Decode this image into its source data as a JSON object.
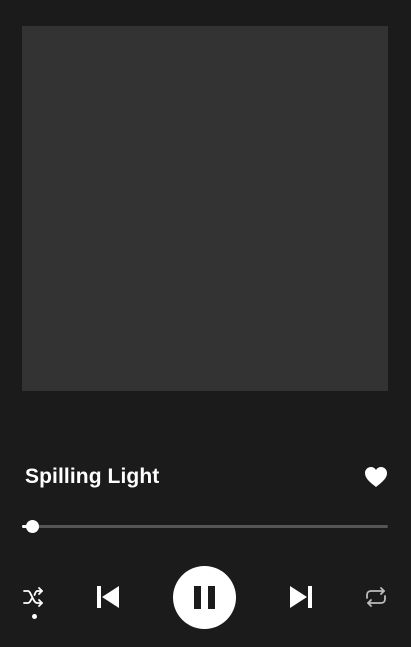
{
  "track": {
    "title": "Spilling Light",
    "liked": true
  },
  "player": {
    "progress": 0.02,
    "is_playing": true,
    "shuffle_active": true,
    "repeat_active": false
  },
  "colors": {
    "background": "#1b1b1b",
    "artwork": "#333333",
    "foreground": "#ffffff",
    "track_inactive": "#555555"
  },
  "icons": {
    "like": "heart-icon",
    "shuffle": "shuffle-icon",
    "previous": "skip-previous-icon",
    "play_pause": "pause-icon",
    "next": "skip-next-icon",
    "repeat": "repeat-icon"
  }
}
